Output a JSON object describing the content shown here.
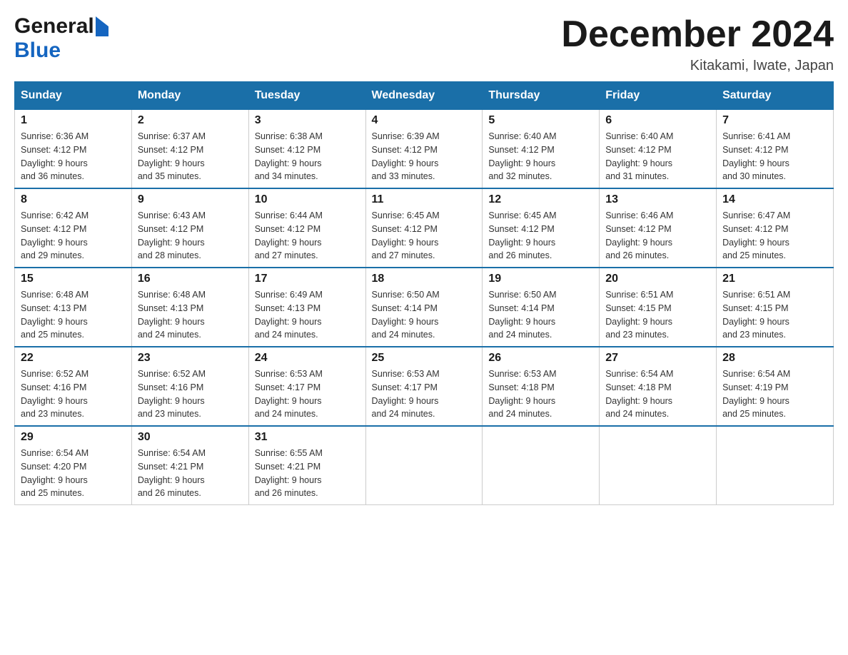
{
  "header": {
    "month_year": "December 2024",
    "location": "Kitakami, Iwate, Japan",
    "logo_general": "General",
    "logo_blue": "Blue"
  },
  "days_of_week": [
    "Sunday",
    "Monday",
    "Tuesday",
    "Wednesday",
    "Thursday",
    "Friday",
    "Saturday"
  ],
  "weeks": [
    [
      {
        "day": "1",
        "sunrise": "6:36 AM",
        "sunset": "4:12 PM",
        "daylight": "9 hours and 36 minutes."
      },
      {
        "day": "2",
        "sunrise": "6:37 AM",
        "sunset": "4:12 PM",
        "daylight": "9 hours and 35 minutes."
      },
      {
        "day": "3",
        "sunrise": "6:38 AM",
        "sunset": "4:12 PM",
        "daylight": "9 hours and 34 minutes."
      },
      {
        "day": "4",
        "sunrise": "6:39 AM",
        "sunset": "4:12 PM",
        "daylight": "9 hours and 33 minutes."
      },
      {
        "day": "5",
        "sunrise": "6:40 AM",
        "sunset": "4:12 PM",
        "daylight": "9 hours and 32 minutes."
      },
      {
        "day": "6",
        "sunrise": "6:40 AM",
        "sunset": "4:12 PM",
        "daylight": "9 hours and 31 minutes."
      },
      {
        "day": "7",
        "sunrise": "6:41 AM",
        "sunset": "4:12 PM",
        "daylight": "9 hours and 30 minutes."
      }
    ],
    [
      {
        "day": "8",
        "sunrise": "6:42 AM",
        "sunset": "4:12 PM",
        "daylight": "9 hours and 29 minutes."
      },
      {
        "day": "9",
        "sunrise": "6:43 AM",
        "sunset": "4:12 PM",
        "daylight": "9 hours and 28 minutes."
      },
      {
        "day": "10",
        "sunrise": "6:44 AM",
        "sunset": "4:12 PM",
        "daylight": "9 hours and 27 minutes."
      },
      {
        "day": "11",
        "sunrise": "6:45 AM",
        "sunset": "4:12 PM",
        "daylight": "9 hours and 27 minutes."
      },
      {
        "day": "12",
        "sunrise": "6:45 AM",
        "sunset": "4:12 PM",
        "daylight": "9 hours and 26 minutes."
      },
      {
        "day": "13",
        "sunrise": "6:46 AM",
        "sunset": "4:12 PM",
        "daylight": "9 hours and 26 minutes."
      },
      {
        "day": "14",
        "sunrise": "6:47 AM",
        "sunset": "4:12 PM",
        "daylight": "9 hours and 25 minutes."
      }
    ],
    [
      {
        "day": "15",
        "sunrise": "6:48 AM",
        "sunset": "4:13 PM",
        "daylight": "9 hours and 25 minutes."
      },
      {
        "day": "16",
        "sunrise": "6:48 AM",
        "sunset": "4:13 PM",
        "daylight": "9 hours and 24 minutes."
      },
      {
        "day": "17",
        "sunrise": "6:49 AM",
        "sunset": "4:13 PM",
        "daylight": "9 hours and 24 minutes."
      },
      {
        "day": "18",
        "sunrise": "6:50 AM",
        "sunset": "4:14 PM",
        "daylight": "9 hours and 24 minutes."
      },
      {
        "day": "19",
        "sunrise": "6:50 AM",
        "sunset": "4:14 PM",
        "daylight": "9 hours and 24 minutes."
      },
      {
        "day": "20",
        "sunrise": "6:51 AM",
        "sunset": "4:15 PM",
        "daylight": "9 hours and 23 minutes."
      },
      {
        "day": "21",
        "sunrise": "6:51 AM",
        "sunset": "4:15 PM",
        "daylight": "9 hours and 23 minutes."
      }
    ],
    [
      {
        "day": "22",
        "sunrise": "6:52 AM",
        "sunset": "4:16 PM",
        "daylight": "9 hours and 23 minutes."
      },
      {
        "day": "23",
        "sunrise": "6:52 AM",
        "sunset": "4:16 PM",
        "daylight": "9 hours and 23 minutes."
      },
      {
        "day": "24",
        "sunrise": "6:53 AM",
        "sunset": "4:17 PM",
        "daylight": "9 hours and 24 minutes."
      },
      {
        "day": "25",
        "sunrise": "6:53 AM",
        "sunset": "4:17 PM",
        "daylight": "9 hours and 24 minutes."
      },
      {
        "day": "26",
        "sunrise": "6:53 AM",
        "sunset": "4:18 PM",
        "daylight": "9 hours and 24 minutes."
      },
      {
        "day": "27",
        "sunrise": "6:54 AM",
        "sunset": "4:18 PM",
        "daylight": "9 hours and 24 minutes."
      },
      {
        "day": "28",
        "sunrise": "6:54 AM",
        "sunset": "4:19 PM",
        "daylight": "9 hours and 25 minutes."
      }
    ],
    [
      {
        "day": "29",
        "sunrise": "6:54 AM",
        "sunset": "4:20 PM",
        "daylight": "9 hours and 25 minutes."
      },
      {
        "day": "30",
        "sunrise": "6:54 AM",
        "sunset": "4:21 PM",
        "daylight": "9 hours and 26 minutes."
      },
      {
        "day": "31",
        "sunrise": "6:55 AM",
        "sunset": "4:21 PM",
        "daylight": "9 hours and 26 minutes."
      },
      null,
      null,
      null,
      null
    ]
  ],
  "labels": {
    "sunrise": "Sunrise:",
    "sunset": "Sunset:",
    "daylight": "Daylight:"
  }
}
